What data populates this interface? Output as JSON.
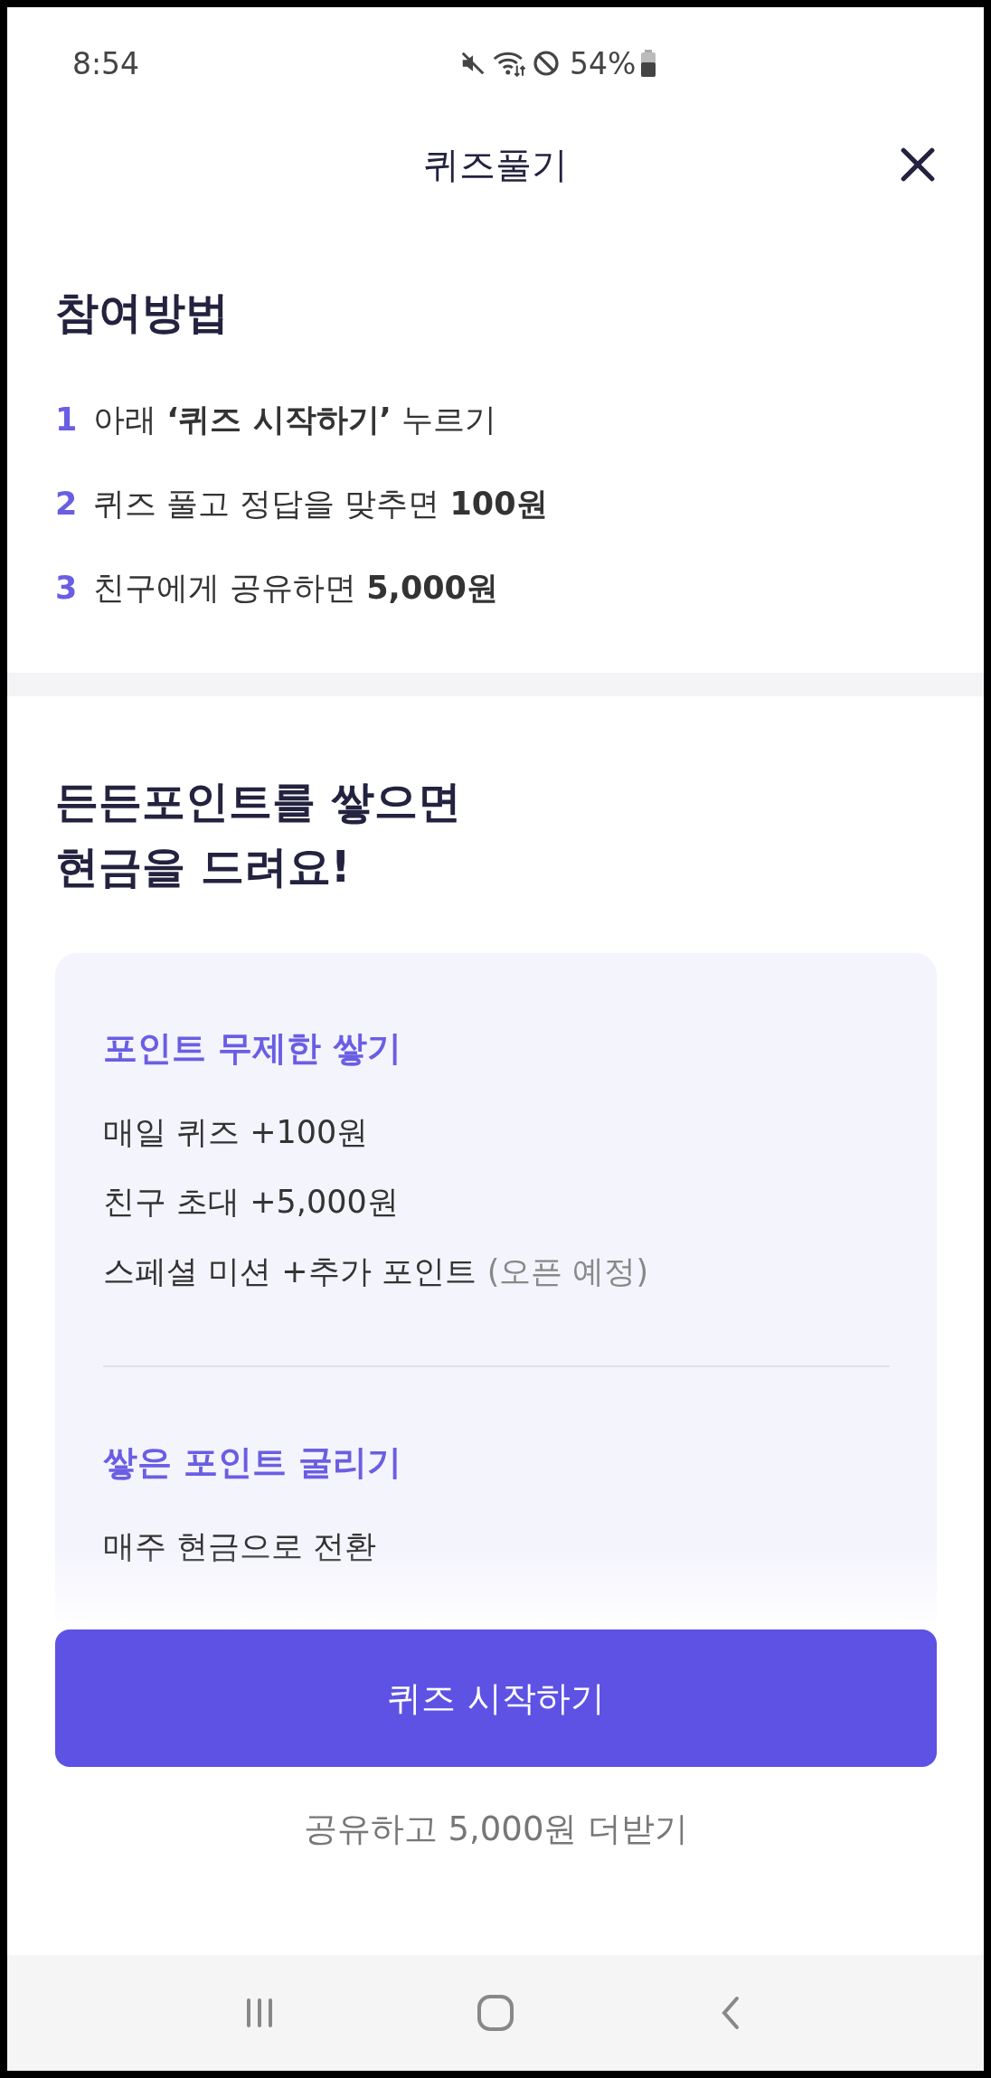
{
  "status_bar": {
    "time": "8:54",
    "battery": "54%"
  },
  "header": {
    "title": "퀴즈풀기"
  },
  "how_to": {
    "title": "참여방법",
    "steps": [
      {
        "number": "1",
        "text": "아래 **‘퀴즈 시작하기’** 누르기"
      },
      {
        "number": "2",
        "text": "퀴즈 풀고 정답을 맞추면 **100원**"
      },
      {
        "number": "3",
        "text": "친구에게 공유하면 **5,000원**"
      }
    ]
  },
  "promo": {
    "title_lines": [
      "든든포인트를 쌓으면",
      "현금을 드려요!"
    ],
    "sections": [
      {
        "title": "포인트 무제한 쌓기",
        "items": [
          {
            "text": "매일 퀴즈 +100원"
          },
          {
            "text": "친구 초대 +5,000원"
          },
          {
            "text": "스페셜 미션 +추가 포인트",
            "note": "(오픈 예정)"
          }
        ]
      },
      {
        "title": "쌓은 포인트 굴리기",
        "items": [
          {
            "text": "매주 현금으로 전환"
          }
        ]
      }
    ]
  },
  "start_button": "퀴즈 시작하기",
  "share_link": "공유하고 5,000원 더받기"
}
